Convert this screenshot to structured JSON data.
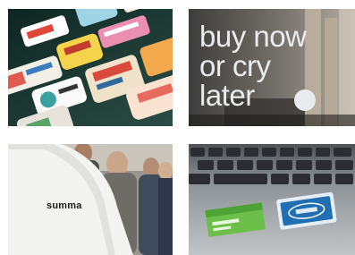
{
  "tiles": [
    {
      "id": "stickers",
      "alt": ""
    },
    {
      "id": "buy-now",
      "lines": [
        "buy now",
        "or cry",
        "later"
      ]
    },
    {
      "id": "summa",
      "label": "summa"
    },
    {
      "id": "laptop",
      "stickers": [
        "",
        ""
      ]
    }
  ],
  "colors": {
    "overlay_text": "#e9ebec",
    "stickers_bg": "#1f3a34",
    "summa_shirt": "#f3f3f1",
    "green_sticker": "#6cc04a",
    "blue_sticker": "#1f6fb2"
  }
}
